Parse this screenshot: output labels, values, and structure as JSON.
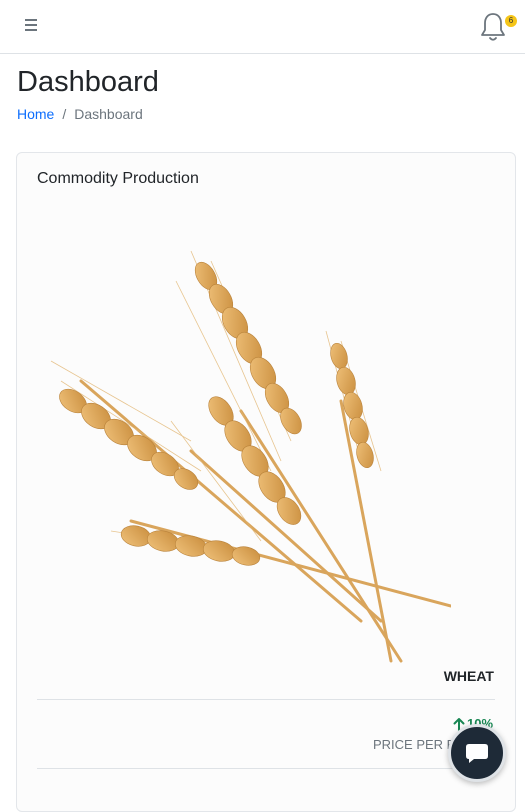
{
  "header": {
    "notification_count": "6"
  },
  "page": {
    "title": "Dashboard",
    "breadcrumb": [
      "Home",
      "Dashboard"
    ],
    "breadcrumb_separator": "/"
  },
  "card": {
    "title": "Commodity Production",
    "commodity": "WHEAT",
    "trend_value": "10%",
    "trend_direction": "up",
    "price_label": "PRICE PER B"
  },
  "colors": {
    "accent": "#0d6efd",
    "badge": "#f5c518",
    "trend_up": "#198754",
    "chat": "#1e2a37"
  },
  "icons": [
    "menu-icon",
    "bell-icon",
    "arrow-up-icon",
    "chat-icon"
  ]
}
